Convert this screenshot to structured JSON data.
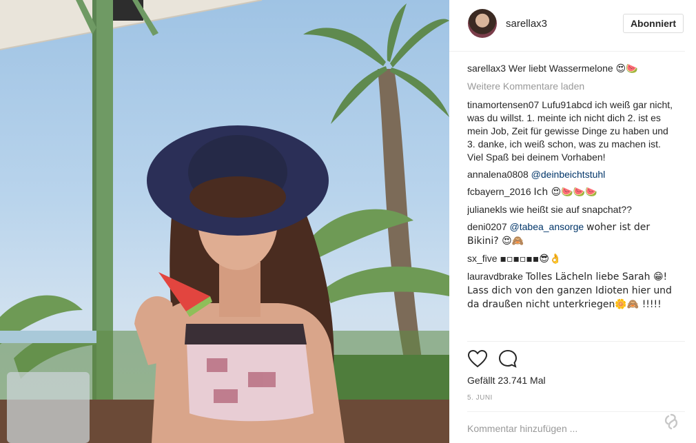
{
  "photo": {
    "alt_subject": "smiling-woman-with-watermelon"
  },
  "header": {
    "username": "sarellax3",
    "follow_label": "Abonniert"
  },
  "caption": {
    "user": "sarellax3",
    "text": "Wer liebt Wassermelone",
    "emoji": "😍🍉"
  },
  "load_more": "Weitere Kommentare laden",
  "comments": [
    {
      "user": "tinamortensen07",
      "text": "Lufu91abcd ich weiß gar nicht, was du willst. 1. meinte ich nicht dich 2. ist es mein Job, Zeit für gewisse Dinge zu haben und 3. danke, ich weiß schon, was zu machen ist. Viel Spaß bei deinem Vorhaben!",
      "mention": ""
    },
    {
      "user": "annalena0808",
      "text": "",
      "mention": "@deinbeichtstuhl"
    },
    {
      "user": "fcbayern_2016",
      "text": "Ich 😍🍉🍉🍉",
      "mention": ""
    },
    {
      "user": "julianekls",
      "text": "wie heißt sie auf snapchat??",
      "mention": ""
    },
    {
      "user": "deni0207",
      "text": "woher ist der Bikini? 😍🙈",
      "mention": "@tabea_ansorge"
    },
    {
      "user": "sx_five",
      "text": "▪▫▪▫▪▪😎👌",
      "mention": ""
    },
    {
      "user": "lauravdbrake",
      "text": "Tolles Lächeln liebe Sarah 😁! Lass dich von den ganzen Idioten hier und da draußen nicht unterkriegen🌼🙈 !!!!!",
      "mention": ""
    }
  ],
  "actions": {
    "like_icon": "heart-icon",
    "comment_icon": "comment-icon"
  },
  "likes": "Gefällt 23.741 Mal",
  "date": "5. JUNI",
  "add_comment_placeholder": "Kommentar hinzufügen ...",
  "colors": {
    "link": "#003569",
    "muted": "#999999",
    "text": "#262626"
  }
}
